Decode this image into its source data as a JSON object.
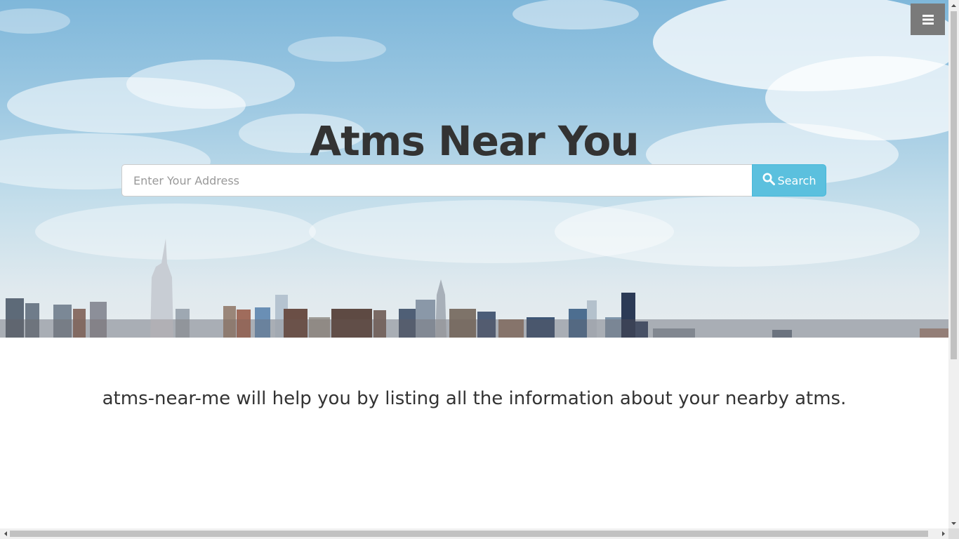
{
  "header": {
    "menu_icon": "hamburger-menu-icon",
    "title": "Atms Near You"
  },
  "search": {
    "placeholder": "Enter Your Address",
    "value": "",
    "button_label": "Search",
    "button_icon": "search-icon"
  },
  "main": {
    "tagline": "atms-near-me will help you by listing all the information about your nearby atms."
  },
  "colors": {
    "accent": "#5bc0de",
    "menu_button": "#7a7a7a",
    "text": "#333333"
  }
}
